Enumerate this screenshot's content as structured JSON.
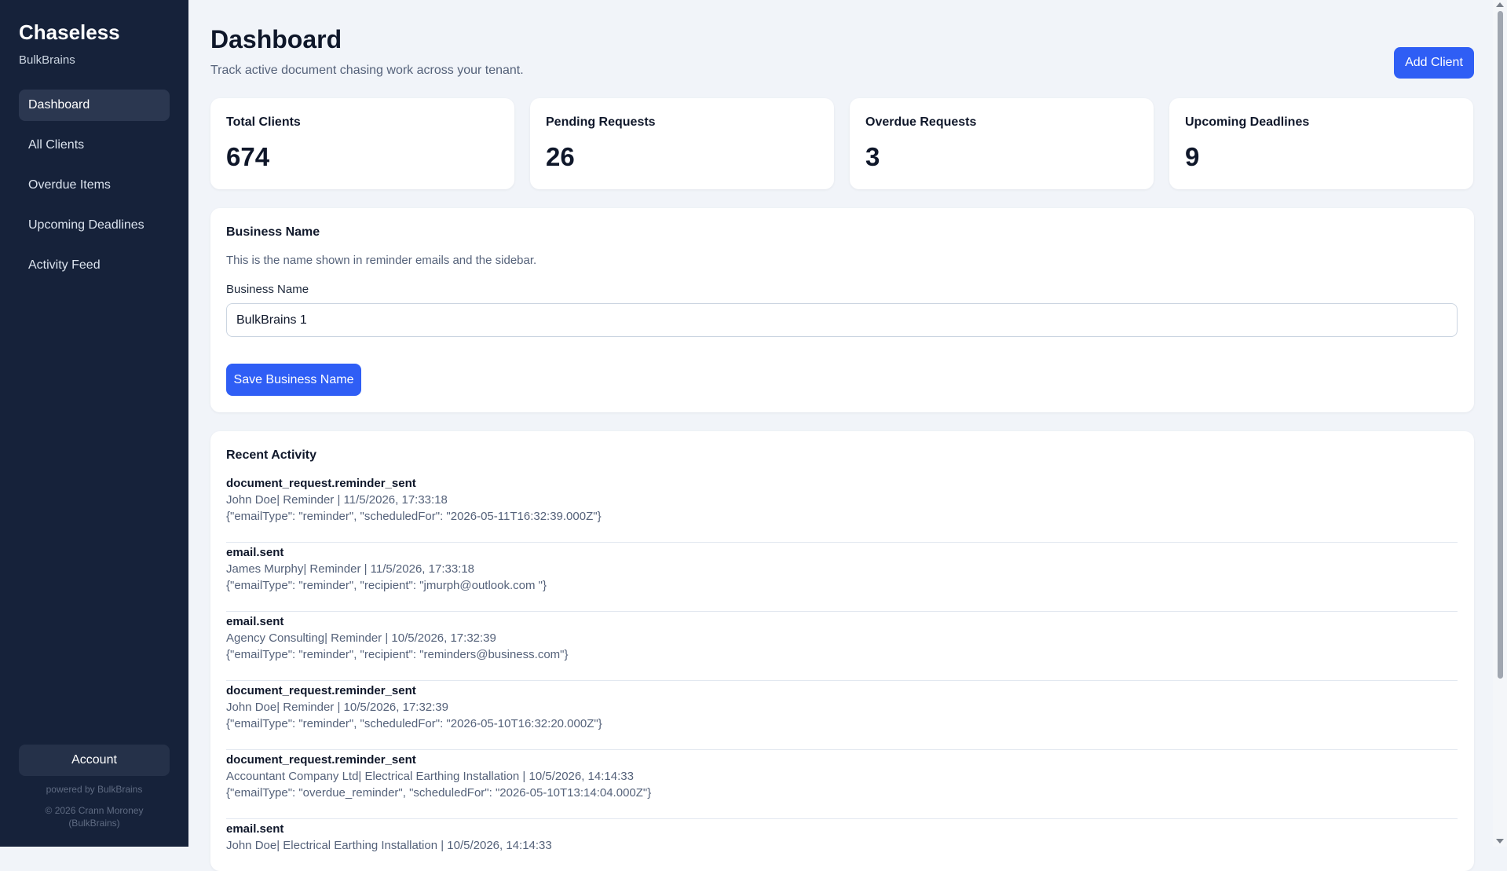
{
  "sidebar": {
    "brand": "Chaseless",
    "tenant": "BulkBrains",
    "items": [
      {
        "label": "Dashboard",
        "active": true
      },
      {
        "label": "All Clients"
      },
      {
        "label": "Overdue Items"
      },
      {
        "label": "Upcoming Deadlines"
      },
      {
        "label": "Activity Feed"
      }
    ],
    "account_label": "Account",
    "powered_by": "powered by BulkBrains",
    "copyright_line1": "© 2026 Crann Moroney",
    "copyright_line2": "(BulkBrains)"
  },
  "header": {
    "title": "Dashboard",
    "subtitle": "Track active document chasing work across your tenant.",
    "add_client_label": "Add Client"
  },
  "stats": [
    {
      "label": "Total Clients",
      "value": "674"
    },
    {
      "label": "Pending Requests",
      "value": "26"
    },
    {
      "label": "Overdue Requests",
      "value": "3"
    },
    {
      "label": "Upcoming Deadlines",
      "value": "9"
    }
  ],
  "business": {
    "heading": "Business Name",
    "description": "This is the name shown in reminder emails and the sidebar.",
    "field_label": "Business Name",
    "value": "BulkBrains 1",
    "save_label": "Save Business Name"
  },
  "activity": {
    "heading": "Recent Activity",
    "items": [
      {
        "title": "document_request.reminder_sent",
        "meta": "John Doe| Reminder | 11/5/2026, 17:33:18",
        "json": "{\"emailType\": \"reminder\", \"scheduledFor\": \"2026-05-11T16:32:39.000Z\"}"
      },
      {
        "title": "email.sent",
        "meta": "James Murphy| Reminder | 11/5/2026, 17:33:18",
        "json": "{\"emailType\": \"reminder\", \"recipient\": \"jmurph@outlook.com \"}"
      },
      {
        "title": "email.sent",
        "meta": "Agency Consulting| Reminder | 10/5/2026, 17:32:39",
        "json": "{\"emailType\": \"reminder\", \"recipient\": \"reminders@business.com\"}"
      },
      {
        "title": "document_request.reminder_sent",
        "meta": "John Doe| Reminder | 10/5/2026, 17:32:39",
        "json": "{\"emailType\": \"reminder\", \"scheduledFor\": \"2026-05-10T16:32:20.000Z\"}"
      },
      {
        "title": "document_request.reminder_sent",
        "meta": "Accountant Company Ltd| Electrical Earthing Installation | 10/5/2026, 14:14:33",
        "json": "{\"emailType\": \"overdue_reminder\", \"scheduledFor\": \"2026-05-10T13:14:04.000Z\"}"
      },
      {
        "title": "email.sent",
        "meta": "John Doe| Electrical Earthing Installation | 10/5/2026, 14:14:33",
        "json": ""
      }
    ]
  },
  "colors": {
    "sidebar_bg": "#16223a",
    "accent": "#2f5ef5",
    "page_bg": "#f1f4f9"
  }
}
